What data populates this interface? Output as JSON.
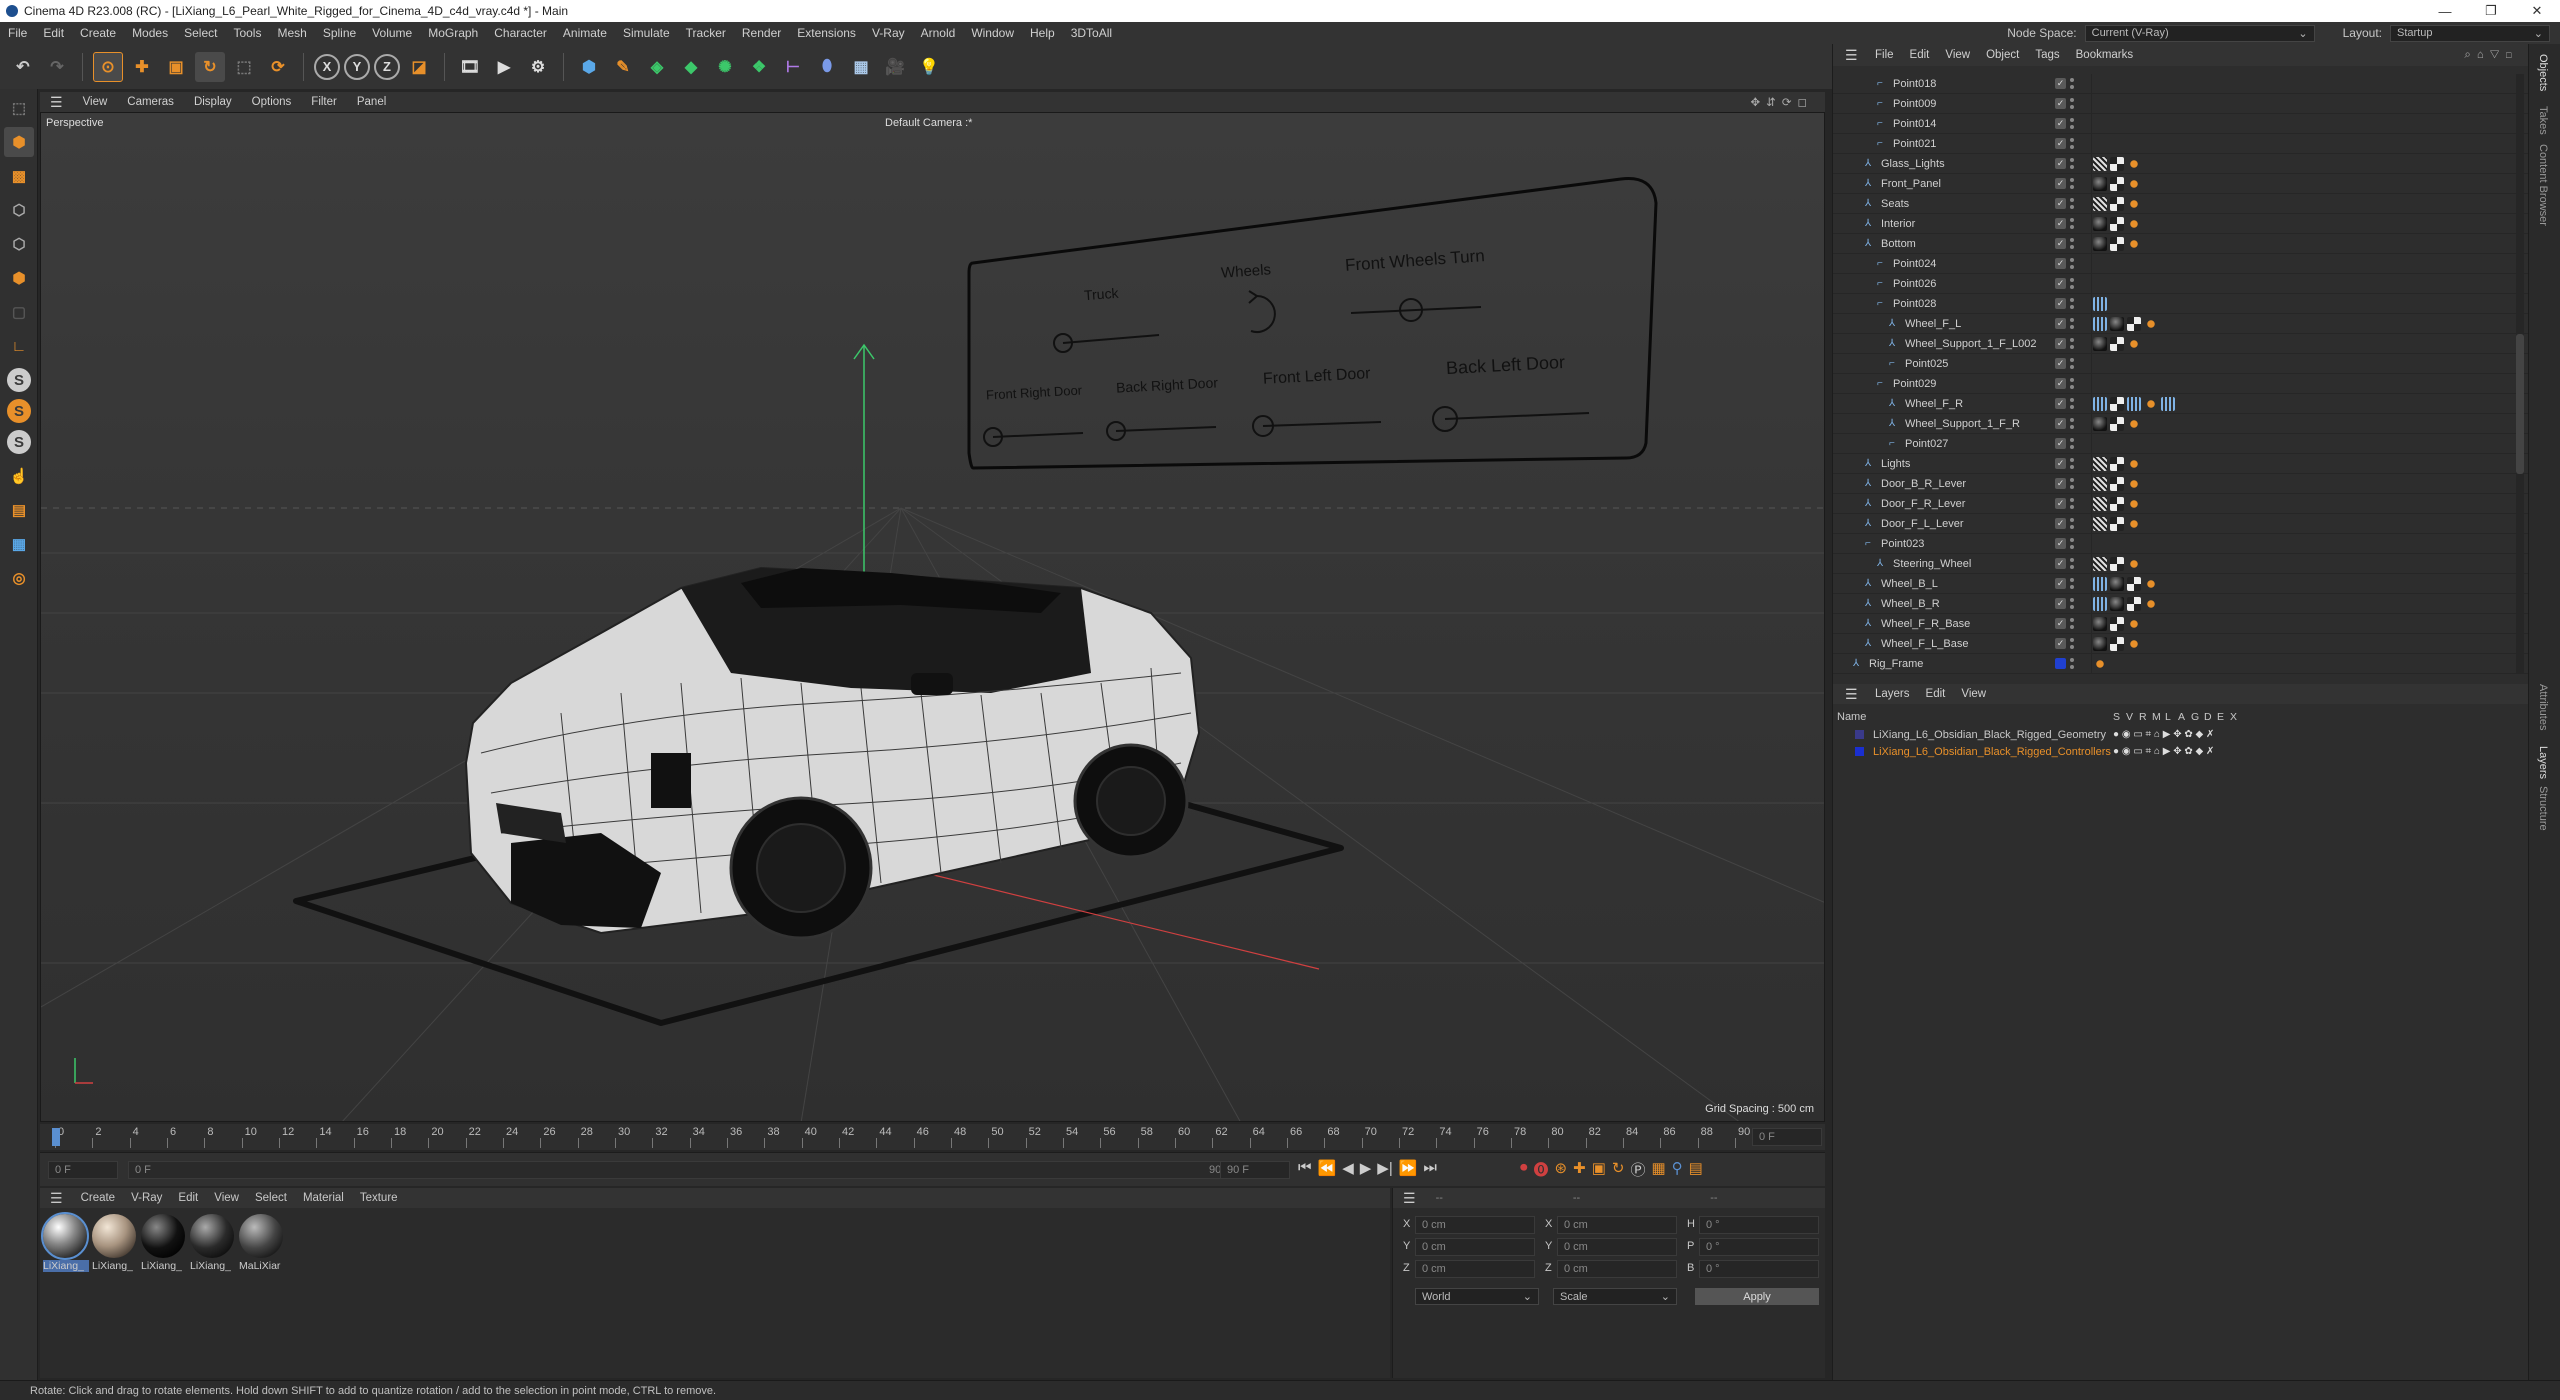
{
  "window": {
    "title": "Cinema 4D R23.008 (RC) - [LiXiang_L6_Pearl_White_Rigged_for_Cinema_4D_c4d_vray.c4d *] - Main",
    "controls": [
      "—",
      "❐",
      "✕"
    ]
  },
  "menu": {
    "items": [
      "File",
      "Edit",
      "Create",
      "Modes",
      "Select",
      "Tools",
      "Mesh",
      "Spline",
      "Volume",
      "MoGraph",
      "Character",
      "Animate",
      "Simulate",
      "Tracker",
      "Render",
      "Extensions",
      "V-Ray",
      "Arnold",
      "Window",
      "Help",
      "3DToAll"
    ],
    "node_space_label": "Node Space:",
    "node_space_value": "Current (V-Ray)",
    "layout_label": "Layout:",
    "layout_value": "Startup"
  },
  "viewport": {
    "menu": [
      "View",
      "Cameras",
      "Display",
      "Options",
      "Filter",
      "Panel"
    ],
    "view_name": "Perspective",
    "camera": "Default Camera :*",
    "grid_spacing": "Grid Spacing : 500 cm",
    "rig_panel": {
      "truck": "Truck",
      "wheels": "Wheels",
      "front_wheels_turn": "Front Wheels Turn",
      "front_right_door": "Front Right Door",
      "back_right_door": "Back Right Door",
      "front_left_door": "Front Left Door",
      "back_left_door": "Back Left Door"
    }
  },
  "timeline": {
    "ticks": [
      "0",
      "2",
      "4",
      "6",
      "8",
      "10",
      "12",
      "14",
      "16",
      "18",
      "20",
      "22",
      "24",
      "26",
      "28",
      "30",
      "32",
      "34",
      "36",
      "38",
      "40",
      "42",
      "44",
      "46",
      "48",
      "50",
      "52",
      "54",
      "56",
      "58",
      "60",
      "62",
      "64",
      "66",
      "68",
      "70",
      "72",
      "74",
      "76",
      "78",
      "80",
      "82",
      "84",
      "86",
      "88",
      "90"
    ],
    "current_frame": "0 F"
  },
  "transport": {
    "start": "0 F",
    "range_start": "0 F",
    "range_end": "90 F",
    "end": "90 F"
  },
  "materials": {
    "menu": [
      "Create",
      "V-Ray",
      "Edit",
      "View",
      "Select",
      "Material",
      "Texture"
    ],
    "items": [
      {
        "label": "LiXiang_",
        "style": "chrome"
      },
      {
        "label": "LiXiang_",
        "style": "beige"
      },
      {
        "label": "LiXiang_",
        "style": "black"
      },
      {
        "label": "LiXiang_",
        "style": "dark"
      },
      {
        "label": "MaLiXiar",
        "style": "darkgray"
      }
    ]
  },
  "coords": {
    "header": [
      "--",
      "--",
      "--"
    ],
    "rows": [
      {
        "a": "X",
        "av": "0 cm",
        "b": "X",
        "bv": "0 cm",
        "c": "H",
        "cv": "0 °"
      },
      {
        "a": "Y",
        "av": "0 cm",
        "b": "Y",
        "bv": "0 cm",
        "c": "P",
        "cv": "0 °"
      },
      {
        "a": "Z",
        "av": "0 cm",
        "b": "Z",
        "bv": "0 cm",
        "c": "B",
        "cv": "0 °"
      }
    ],
    "world": "World",
    "scale": "Scale",
    "apply": "Apply"
  },
  "objects": {
    "menu": [
      "File",
      "Edit",
      "View",
      "Object",
      "Tags",
      "Bookmarks"
    ],
    "rows": [
      {
        "name": "Point018",
        "indent": 2,
        "tags": []
      },
      {
        "name": "Point009",
        "indent": 2,
        "tags": []
      },
      {
        "name": "Point014",
        "indent": 2,
        "tags": []
      },
      {
        "name": "Point021",
        "indent": 2,
        "tags": []
      },
      {
        "name": "Glass_Lights",
        "indent": 1,
        "tags": [
          "wire",
          "check",
          "org"
        ]
      },
      {
        "name": "Front_Panel",
        "indent": 1,
        "tags": [
          "ball",
          "check",
          "org"
        ]
      },
      {
        "name": "Seats",
        "indent": 1,
        "tags": [
          "wire",
          "check",
          "org"
        ]
      },
      {
        "name": "Interior",
        "indent": 1,
        "tags": [
          "ball",
          "check",
          "org"
        ]
      },
      {
        "name": "Bottom",
        "indent": 1,
        "tags": [
          "ball",
          "check",
          "org"
        ]
      },
      {
        "name": "Point024",
        "indent": 2,
        "tags": []
      },
      {
        "name": "Point026",
        "indent": 2,
        "tags": []
      },
      {
        "name": "Point028",
        "indent": 2,
        "tags": [
          "rig"
        ]
      },
      {
        "name": "Wheel_F_L",
        "indent": 3,
        "tags": [
          "rig",
          "ball",
          "check",
          "org"
        ]
      },
      {
        "name": "Wheel_Support_1_F_L002",
        "indent": 3,
        "tags": [
          "ball",
          "check",
          "org"
        ]
      },
      {
        "name": "Point025",
        "indent": 3,
        "tags": []
      },
      {
        "name": "Point029",
        "indent": 2,
        "tags": []
      },
      {
        "name": "Wheel_F_R",
        "indent": 3,
        "tags": [
          "rig",
          "check",
          "rig",
          "org",
          "rig"
        ]
      },
      {
        "name": "Wheel_Support_1_F_R",
        "indent": 3,
        "tags": [
          "ball",
          "check",
          "org"
        ]
      },
      {
        "name": "Point027",
        "indent": 3,
        "tags": []
      },
      {
        "name": "Lights",
        "indent": 1,
        "tags": [
          "wire",
          "check",
          "org"
        ]
      },
      {
        "name": "Door_B_R_Lever",
        "indent": 1,
        "tags": [
          "wire",
          "check",
          "org"
        ]
      },
      {
        "name": "Door_F_R_Lever",
        "indent": 1,
        "tags": [
          "wire",
          "check",
          "org"
        ]
      },
      {
        "name": "Door_F_L_Lever",
        "indent": 1,
        "tags": [
          "wire",
          "check",
          "org"
        ]
      },
      {
        "name": "Point023",
        "indent": 1,
        "tags": []
      },
      {
        "name": "Steering_Wheel",
        "indent": 2,
        "tags": [
          "wire",
          "check",
          "org"
        ]
      },
      {
        "name": "Wheel_B_L",
        "indent": 1,
        "tags": [
          "rig",
          "ball",
          "check",
          "org"
        ]
      },
      {
        "name": "Wheel_B_R",
        "indent": 1,
        "tags": [
          "rig",
          "ball",
          "check",
          "org"
        ]
      },
      {
        "name": "Wheel_F_R_Base",
        "indent": 1,
        "tags": [
          "ball",
          "check",
          "org"
        ]
      },
      {
        "name": "Wheel_F_L_Base",
        "indent": 1,
        "tags": [
          "ball",
          "check",
          "org"
        ]
      },
      {
        "name": "Rig_Frame",
        "indent": 0,
        "tags": [
          "org"
        ]
      }
    ]
  },
  "layers": {
    "menu": [
      "Layers",
      "Edit",
      "View"
    ],
    "name_header": "Name",
    "col_headers": [
      "S",
      "V",
      "R",
      "M",
      "L",
      "A",
      "G",
      "D",
      "E",
      "X"
    ],
    "rows": [
      {
        "name": "LiXiang_L6_Obsidian_Black_Rigged_Geometry",
        "color": "#3a3a8a",
        "text_color": "#c8c8c8"
      },
      {
        "name": "LiXiang_L6_Obsidian_Black_Rigged_Controllers",
        "color": "#1a2fd0",
        "text_color": "#e8902a"
      }
    ]
  },
  "right_tabs": [
    "Objects",
    "Takes",
    "Content Browser",
    "Attributes",
    "Layers",
    "Structure"
  ],
  "status": "Rotate: Click and drag to rotate elements. Hold down SHIFT to add to quantize rotation / add to the selection in point mode, CTRL to remove."
}
